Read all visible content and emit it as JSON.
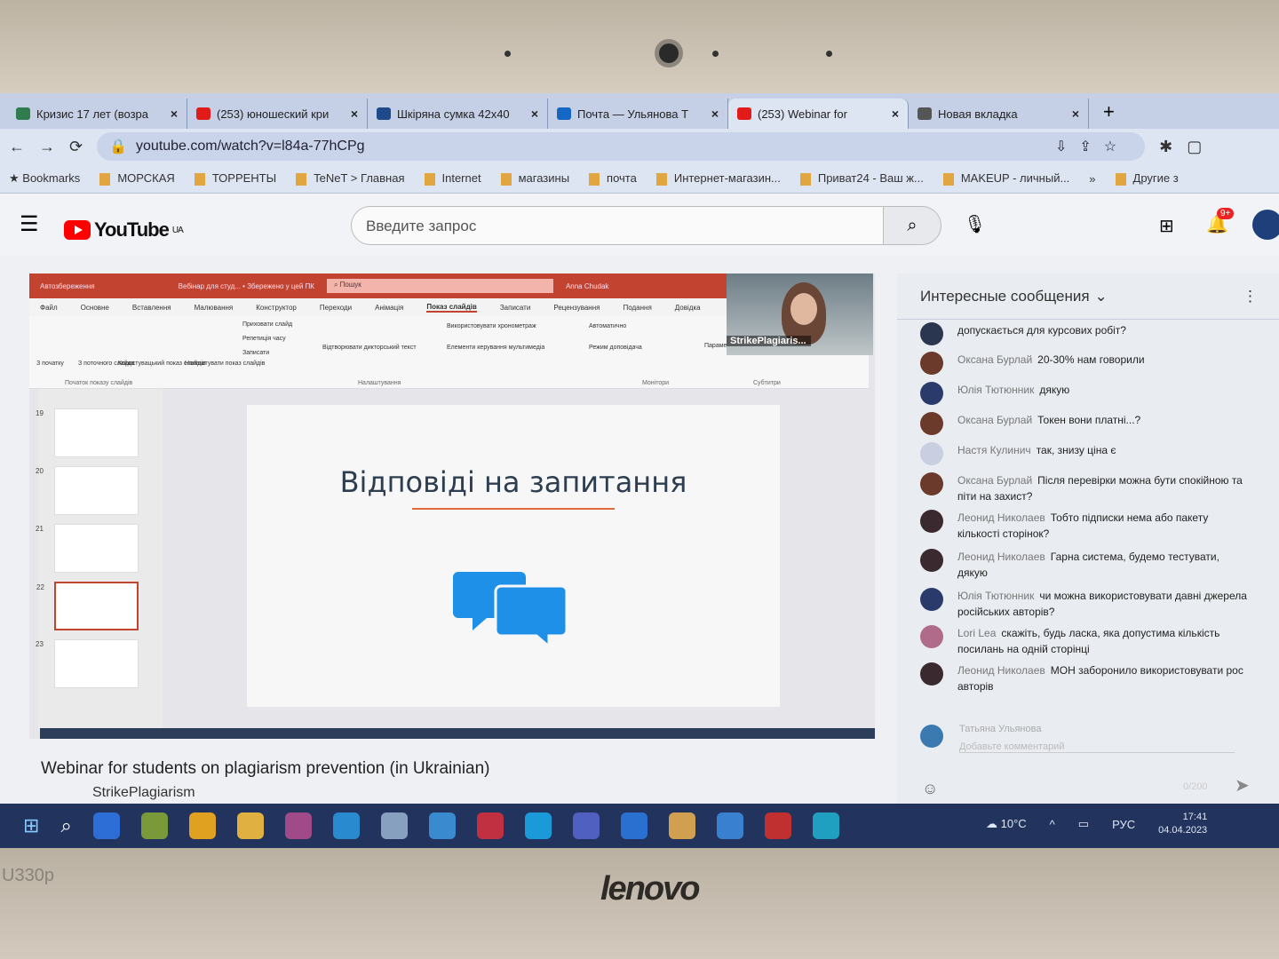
{
  "browser": {
    "tabs": [
      {
        "title": "Кризис 17 лет (возра",
        "color": "#2f7d4f"
      },
      {
        "title": "(253) юношеский кри",
        "color": "#e21a1a"
      },
      {
        "title": "Шкіряна сумка 42х40",
        "color": "#1c4a8a"
      },
      {
        "title": "Почта — Ульянова Т",
        "color": "#1467c4"
      },
      {
        "title": "(253) Webinar for",
        "color": "#e21a1a",
        "active": true
      },
      {
        "title": "Новая вкладка",
        "color": "#555"
      }
    ],
    "new_tab": "+",
    "url": "youtube.com/watch?v=l84a-77hCPg",
    "bookmarks": [
      "Bookmarks",
      "МОРСКАЯ",
      "ТОРРЕНТЫ",
      "TeNeT > Главная",
      "Internet",
      "магазины",
      "почта",
      "Интернет-магазин...",
      "Приват24 - Ваш ж...",
      "MAKEUP - личный...",
      "»",
      "Другие з"
    ]
  },
  "youtube": {
    "logo": "YouTube",
    "region": "UA",
    "search_placeholder": "Введите запрос",
    "notifications_badge": "9+",
    "video_title": "Webinar for students on plagiarism prevention (in Ukrainian)",
    "channel": "StrikePlagiarism"
  },
  "presentation": {
    "title_bar": {
      "autosave": "Автозбереження",
      "doc": "Вебінар для студ... • Збережено у цей ПК",
      "search": "Пошук",
      "user": "Anna Chudak"
    },
    "menu": [
      "Файл",
      "Основне",
      "Вставлення",
      "Малювання",
      "Конструктор",
      "Переходи",
      "Анімація",
      "Показ слайдів",
      "Записати",
      "Рецензування",
      "Подання",
      "Довідка"
    ],
    "active_menu": "Показ слайдів",
    "ribbon": [
      "З початку",
      "З поточного слайда",
      "Користувацький показ слайдів",
      "Налаштувати показ слайдів",
      "Приховати слайд",
      "Репетиція часу",
      "Записати",
      "Використовувати хронометраж",
      "Відтворювати дикторський текст",
      "Елементи керування мультимедіа",
      "Автоматично",
      "Режим доповідача",
      "Параметри субтитрів"
    ],
    "ribbon_groups": [
      "Початок показу слайдів",
      "Налаштування",
      "Монітори",
      "Субтитри"
    ],
    "slide_numbers": [
      "19",
      "20",
      "21",
      "22",
      "23"
    ],
    "slide_title": "Відповіді на запитання",
    "webcam_label": "StrikePlagiaris..."
  },
  "chat": {
    "header": "Интересные сообщения",
    "messages": [
      {
        "author": "",
        "text": "допускається для курсових робіт?",
        "color": "#2a3550"
      },
      {
        "author": "Оксана Бурлай",
        "text": "20-30% нам говорили",
        "color": "#6b3a2a"
      },
      {
        "author": "Юлія Тютюнник",
        "text": "дякую",
        "color": "#2a3a6a"
      },
      {
        "author": "Оксана Бурлай",
        "text": "Токен вони платні...?",
        "color": "#6b3a2a"
      },
      {
        "author": "Настя Кулинич",
        "text": "так, знизу ціна є",
        "color": "#c9cfe0"
      },
      {
        "author": "Оксана Бурлай",
        "text": "Після перевірки можна бути спокійною та піти на захист?",
        "color": "#6b3a2a"
      },
      {
        "author": "Леонид Николаев",
        "text": "Тобто підписки нема або пакету кількості сторінок?",
        "color": "#3a2a30"
      },
      {
        "author": "Леонид Николаев",
        "text": "Гарна система, будемо тестувати, дякую",
        "color": "#3a2a30"
      },
      {
        "author": "Юлія Тютюнник",
        "text": "чи можна використовувати давні джерела російських авторів?",
        "color": "#2a3a6a"
      },
      {
        "author": "Lori Lea",
        "text": "скажіть, будь ласка, яка допустима кількість посилань на одній сторінці",
        "color": "#b06a8a"
      },
      {
        "author": "Леонид Николаев",
        "text": "МОН заборонило використовувати рос авторів",
        "color": "#3a2a30"
      }
    ],
    "composer_name": "Татьяна Ульянова",
    "composer_placeholder": "Добавьте комментарий",
    "counter": "0/200"
  },
  "taskbar": {
    "weather": "10°C",
    "lang": "РУС",
    "time": "17:41",
    "date": "04.04.2023",
    "icons": [
      "#2d6ed6",
      "#7a9a3a",
      "#e0a020",
      "#e0b040",
      "#a04a8a",
      "#2a8ad0",
      "#88a0c0",
      "#3a8ad0",
      "#c03040",
      "#1a9ad8",
      "#5060c0",
      "#2a70d0",
      "#d0a050",
      "#3a80d0",
      "#c03030",
      "#20a0c0",
      "#3a5ad0",
      "#2a5ab0"
    ]
  },
  "laptop": {
    "brand": "lenovo",
    "model": "U330p"
  }
}
